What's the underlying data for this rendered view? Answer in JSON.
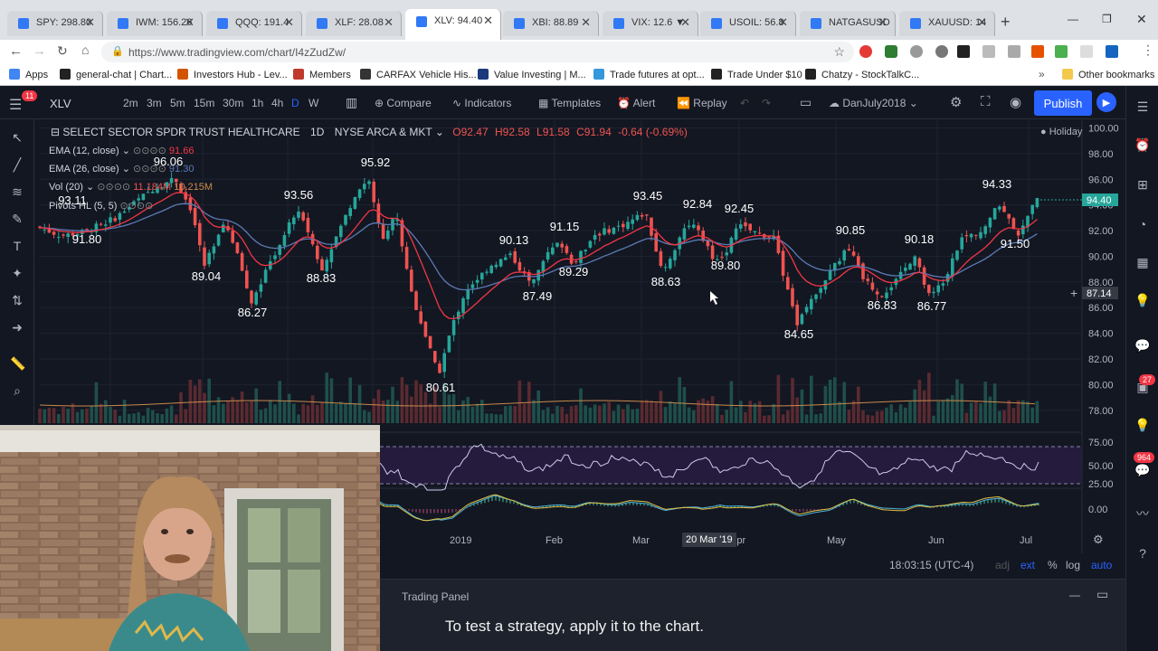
{
  "browser": {
    "tabs": [
      {
        "label": "SPY: 298.80"
      },
      {
        "label": "IWM: 156.26"
      },
      {
        "label": "QQQ: 191.4"
      },
      {
        "label": "XLF: 28.08"
      },
      {
        "label": "XLV: 94.40"
      },
      {
        "label": "XBI: 88.89"
      },
      {
        "label": "VIX: 12.6 ▼"
      },
      {
        "label": "USOIL: 56.8"
      },
      {
        "label": "NATGASUSD"
      },
      {
        "label": "XAUUSD: 14"
      }
    ],
    "active_tab_index": 4,
    "url": "https://www.tradingview.com/chart/I4zZudZw/",
    "bookmarks": [
      {
        "label": "Apps"
      },
      {
        "label": "general-chat | Chart..."
      },
      {
        "label": "Investors Hub - Lev..."
      },
      {
        "label": "Members"
      },
      {
        "label": "CARFAX Vehicle His..."
      },
      {
        "label": "Value Investing | M..."
      },
      {
        "label": "Trade futures at opt..."
      },
      {
        "label": "Trade Under $10"
      },
      {
        "label": "Chatzy - StockTalkC..."
      }
    ],
    "other_bookmarks": "Other bookmarks",
    "menu_badge": "11"
  },
  "toolbar": {
    "symbol": "XLV",
    "intervals": [
      "2m",
      "3m",
      "5m",
      "15m",
      "30m",
      "1h",
      "4h",
      "D",
      "W"
    ],
    "active_interval": "D",
    "compare": "Compare",
    "indicators": "Indicators",
    "templates": "Templates",
    "alert": "Alert",
    "replay": "Replay",
    "layout_name": "DanJuly2018",
    "publish": "Publish"
  },
  "legend": {
    "title": "SELECT SECTOR SPDR TRUST HEALTHCARE",
    "interval": "1D",
    "exchange": "NYSE ARCA & MKT",
    "open": "O92.47",
    "high": "H92.58",
    "low": "L91.58",
    "close": "C91.94",
    "change": "-0.64 (-0.69%)",
    "ema12": "EMA (12, close)",
    "ema12_val": "91.66",
    "ema26": "EMA (26, close)",
    "ema26_val": "91.30",
    "vol": "Vol (20)",
    "vol_val1": "11.184M",
    "vol_val2": "10.215M",
    "pivots": "Pivots HL (5, 5)",
    "holiday": "Holiday"
  },
  "chart_data": {
    "type": "candlestick",
    "symbol": "XLV",
    "price_axis": [
      "100.00",
      "98.00",
      "96.00",
      "94.00",
      "92.00",
      "90.00",
      "88.00",
      "86.00",
      "84.00",
      "82.00",
      "80.00",
      "78.00"
    ],
    "ylim": [
      77,
      100.6
    ],
    "last_price": "94.40",
    "crosshair_price": "87.14",
    "pivots_high": [
      {
        "label": "93.11"
      },
      {
        "label": "96.06"
      },
      {
        "label": "95.92"
      },
      {
        "label": "93.56"
      },
      {
        "label": "90.13"
      },
      {
        "label": "91.15"
      },
      {
        "label": "93.45"
      },
      {
        "label": "92.84"
      },
      {
        "label": "92.45"
      },
      {
        "label": "90.85"
      },
      {
        "label": "90.18"
      },
      {
        "label": "94.33"
      }
    ],
    "pivots_low": [
      {
        "label": "91.80"
      },
      {
        "label": "89.04"
      },
      {
        "label": "86.27"
      },
      {
        "label": "88.83"
      },
      {
        "label": "80.61"
      },
      {
        "label": "87.49"
      },
      {
        "label": "89.29"
      },
      {
        "label": "88.63"
      },
      {
        "label": "89.80"
      },
      {
        "label": "84.65"
      },
      {
        "label": "86.83"
      },
      {
        "label": "86.77"
      },
      {
        "label": "91.50"
      }
    ],
    "rsi_axis": [
      "75.00",
      "50.00",
      "25.00"
    ],
    "macd_axis": [
      "0.00"
    ],
    "time_labels": [
      "2019",
      "Feb",
      "Mar",
      "Apr",
      "May",
      "Jun",
      "Jul"
    ],
    "crosshair_date": "20 Mar '19"
  },
  "status": {
    "time": "18:03:15 (UTC-4)",
    "adj": "adj",
    "ext": "ext",
    "pct": "%",
    "log": "log",
    "auto": "auto"
  },
  "panel": {
    "tab": "Trading Panel",
    "caption": "To test a strategy, apply it to the chart."
  },
  "right_badges": {
    "badge1": "27",
    "badge2": "964"
  },
  "colors": {
    "bg": "#131722",
    "up": "#26a69a",
    "down": "#ef5350",
    "ema12": "#f23645",
    "ema26": "#5b7bb5",
    "rsi": "#d0c8f0",
    "accent": "#2962ff"
  }
}
